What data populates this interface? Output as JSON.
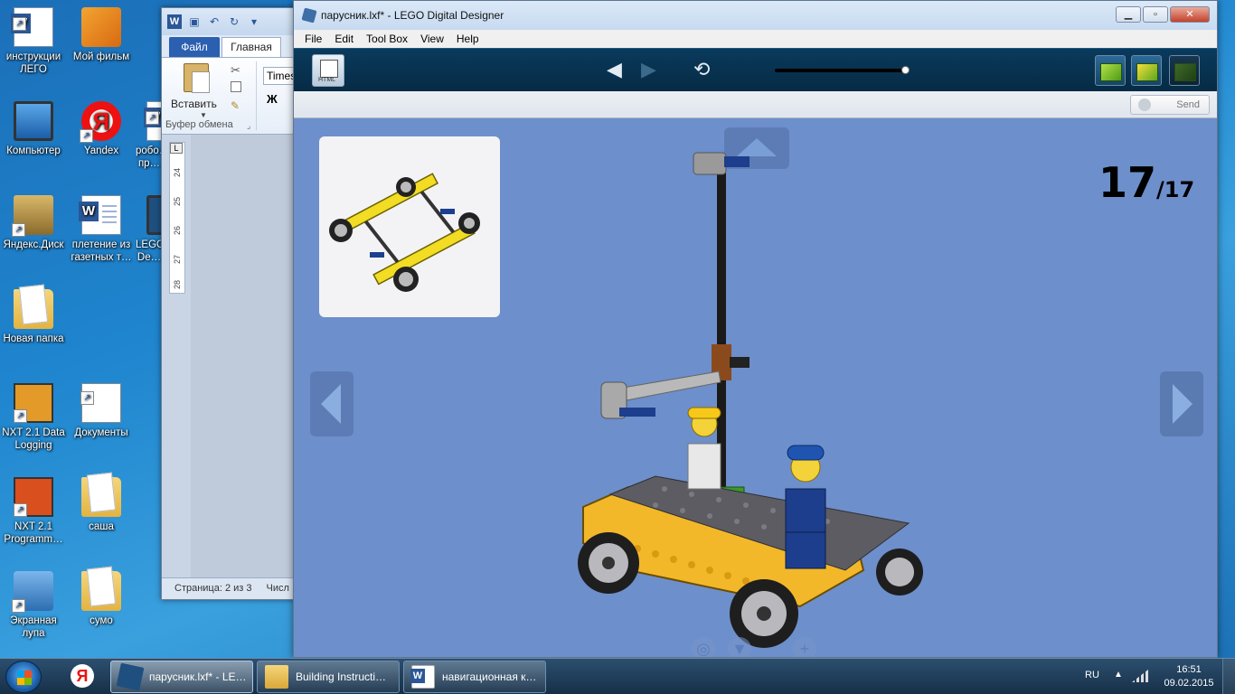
{
  "desktop": {
    "icons": [
      {
        "label": "инструкции ЛЕГО",
        "icon": "word-document-icon"
      },
      {
        "label": "Мой фильм",
        "icon": "movie-maker-icon"
      },
      {
        "label": "Компьютер",
        "icon": "computer-icon"
      },
      {
        "label": "Yandex",
        "icon": "yandex-browser-icon"
      },
      {
        "label": "робо… пр…",
        "icon": "word-document-icon"
      },
      {
        "label": "Яндекс.Диск",
        "icon": "yandex-disk-icon"
      },
      {
        "label": "плетение из газетных т…",
        "icon": "word-document-icon"
      },
      {
        "label": "LEGO De…",
        "icon": "lego-digital-designer-icon"
      },
      {
        "label": "Новая папка",
        "icon": "folder-icon"
      },
      {
        "label": "NXT 2.1 Data Logging",
        "icon": "nxt-data-logging-icon"
      },
      {
        "label": "Документы",
        "icon": "documents-icon"
      },
      {
        "label": "NXT 2.1 Programm…",
        "icon": "nxt-programming-icon"
      },
      {
        "label": "саша",
        "icon": "folder-icon"
      },
      {
        "label": "Экранная лупа",
        "icon": "magnifier-icon"
      },
      {
        "label": "сумо",
        "icon": "folder-icon"
      }
    ]
  },
  "word": {
    "tabs": {
      "file": "Файл",
      "home": "Главная"
    },
    "paste_label": "Вставить",
    "clipboard_label": "Буфер обмена",
    "font_name": "Times",
    "bold_label": "Ж",
    "ruler_numbers": [
      "24",
      "25",
      "26",
      "27",
      "28"
    ],
    "status_page": "Страница: 2 из 3",
    "status_words": "Числ"
  },
  "lego": {
    "title": "парусник.lxf* - LEGO Digital Designer",
    "menu": [
      "File",
      "Edit",
      "Tool Box",
      "View",
      "Help"
    ],
    "toolbar": {
      "html_label": "HTML",
      "prev_icon": "◀",
      "next_icon": "▶",
      "rotate_icon": "⟲",
      "slider_value": 1.0
    },
    "send_label": "Send",
    "step": {
      "current": "17",
      "total": "/17"
    },
    "colors": {
      "canvas_bg": "#6d8fcb",
      "toolbar_bg": "#062b45"
    }
  },
  "taskbar": {
    "tasks": [
      {
        "label": "парусник.lxf* - LE…",
        "icon": "lego-task-icon",
        "active": true
      },
      {
        "label": "Building Instructi…",
        "icon": "folder-task-icon",
        "active": false
      },
      {
        "label": "навигационная к…",
        "icon": "word-task-icon",
        "active": false
      }
    ],
    "lang": "RU",
    "time": "16:51",
    "date": "09.02.2015"
  }
}
